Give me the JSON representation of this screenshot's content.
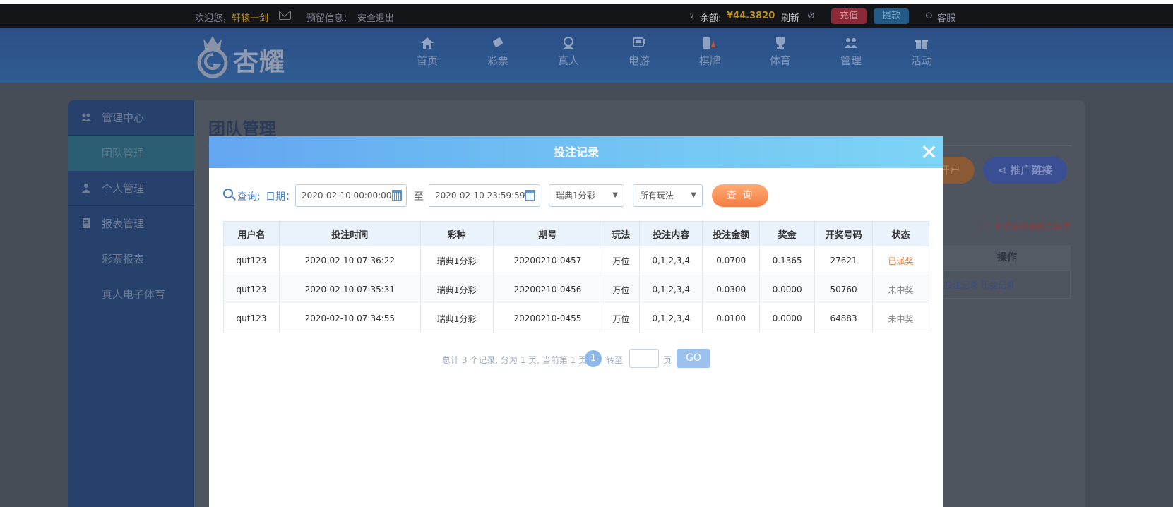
{
  "topbar": {
    "welcome": "欢迎您，",
    "username": "轩辕一剑",
    "reserved_label": "预留信息：",
    "logout": "安全退出",
    "balance_label": "余额:",
    "balance_value": "¥44.3820",
    "refresh": "刷新",
    "recharge": "充值",
    "withdraw": "提款",
    "service": "客服"
  },
  "logo": {
    "text": "杏耀"
  },
  "nav": [
    {
      "label": "首页",
      "icon": "home-icon"
    },
    {
      "label": "彩票",
      "icon": "lottery-icon"
    },
    {
      "label": "真人",
      "icon": "live-icon"
    },
    {
      "label": "电游",
      "icon": "slot-icon"
    },
    {
      "label": "棋牌",
      "icon": "chess-icon"
    },
    {
      "label": "体育",
      "icon": "trophy-icon"
    },
    {
      "label": "管理",
      "icon": "users-icon"
    },
    {
      "label": "活动",
      "icon": "gift-icon"
    }
  ],
  "sidebar": {
    "items": [
      {
        "label": "管理中心",
        "icon": "users-icon"
      },
      {
        "label": "团队管理"
      },
      {
        "label": "个人管理",
        "icon": "user-icon"
      },
      {
        "label": "报表管理",
        "icon": "report-icon"
      },
      {
        "label": "彩票报表"
      },
      {
        "label": "真人电子体育"
      }
    ]
  },
  "background": {
    "page_title": "团队管理",
    "open_account": "开户",
    "promo_link": "推广链接",
    "note": "注：可点击标题修改排序",
    "op_header": "操作",
    "op_links": "投注记录 账变记录"
  },
  "modal": {
    "title": "投注记录",
    "query_label": "查询:",
    "date_label": "日期：",
    "date_from": "2020-02-10 00:00:00",
    "to_label": "至",
    "date_to": "2020-02-10 23:59:59",
    "lottery_select": "瑞典1分彩",
    "play_select": "所有玩法",
    "query_button": "查 询",
    "columns": [
      "用户名",
      "投注时间",
      "彩种",
      "期号",
      "玩法",
      "投注内容",
      "投注金额",
      "奖金",
      "开奖号码",
      "状态"
    ],
    "rows": [
      [
        "qut123",
        "2020-02-10 07:36:22",
        "瑞典1分彩",
        "20200210-0457",
        "万位",
        "0,1,2,3,4",
        "0.0700",
        "0.1365",
        "27621",
        "已派奖"
      ],
      [
        "qut123",
        "2020-02-10 07:35:31",
        "瑞典1分彩",
        "20200210-0456",
        "万位",
        "0,1,2,3,4",
        "0.0300",
        "0.0000",
        "50760",
        "未中奖"
      ],
      [
        "qut123",
        "2020-02-10 07:34:55",
        "瑞典1分彩",
        "20200210-0455",
        "万位",
        "0,1,2,3,4",
        "0.0100",
        "0.0000",
        "64883",
        "未中奖"
      ]
    ],
    "pager": {
      "summary": "总计 3 个记录, 分为 1 页, 当前第 1 页",
      "current": "1",
      "goto_label": "转至",
      "page_unit": "页",
      "go": "GO"
    }
  },
  "colors": {
    "accent_blue": "#6aaef2",
    "query_orange": "#f47d43",
    "paid_status": "#e8782e"
  }
}
